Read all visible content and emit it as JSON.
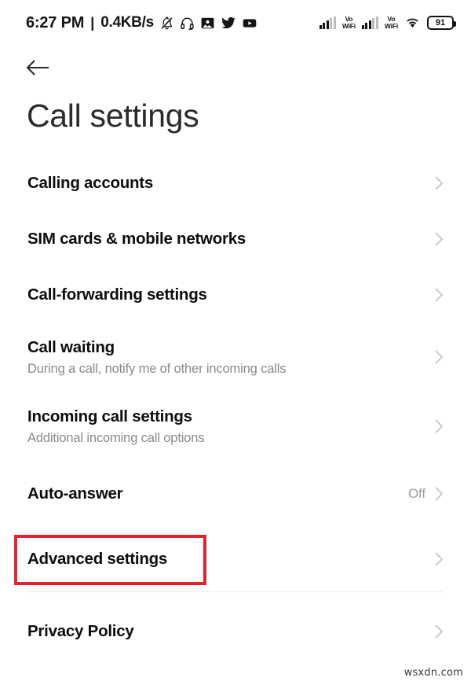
{
  "status_bar": {
    "clock": "6:27 PM",
    "separator": "|",
    "network_speed": "0.4KB/s",
    "left_icons": [
      "bell-muted-icon",
      "headphones-icon",
      "gallery-icon",
      "twitter-icon",
      "youtube-icon"
    ],
    "right_icons": [
      "signal-bars-icon",
      "vowifi-label",
      "signal-bars-icon",
      "vowifi-label",
      "wifi-icon",
      "battery-icon"
    ],
    "vowifi_top": "Vo",
    "vowifi_bottom": "WiFi",
    "battery_level": "91"
  },
  "header": {
    "back_icon": "arrow-left-icon",
    "title": "Call settings"
  },
  "list": {
    "items": [
      {
        "title": "Calling accounts",
        "subtitle": "",
        "value": "",
        "chevron": "chevron-right-icon"
      },
      {
        "title": "SIM cards & mobile networks",
        "subtitle": "",
        "value": "",
        "chevron": "chevron-right-icon"
      },
      {
        "title": "Call-forwarding settings",
        "subtitle": "",
        "value": "",
        "chevron": "chevron-right-icon"
      },
      {
        "title": "Call waiting",
        "subtitle": "During a call, notify me of other incoming calls",
        "value": "",
        "chevron": "chevron-right-icon"
      },
      {
        "title": "Incoming call settings",
        "subtitle": "Additional incoming call options",
        "value": "",
        "chevron": "chevron-right-icon"
      },
      {
        "title": "Auto-answer",
        "subtitle": "",
        "value": "Off",
        "chevron": "chevron-right-icon"
      },
      {
        "title": "Advanced settings",
        "subtitle": "",
        "value": "",
        "chevron": "chevron-right-icon"
      }
    ],
    "footer_items": [
      {
        "title": "Privacy Policy",
        "subtitle": "",
        "value": "",
        "chevron": "chevron-right-icon"
      }
    ]
  },
  "annotation": {
    "highlight_color": "#e0232e",
    "highlight_target": "Advanced settings"
  },
  "watermark": {
    "text": "wsxdn.com"
  }
}
